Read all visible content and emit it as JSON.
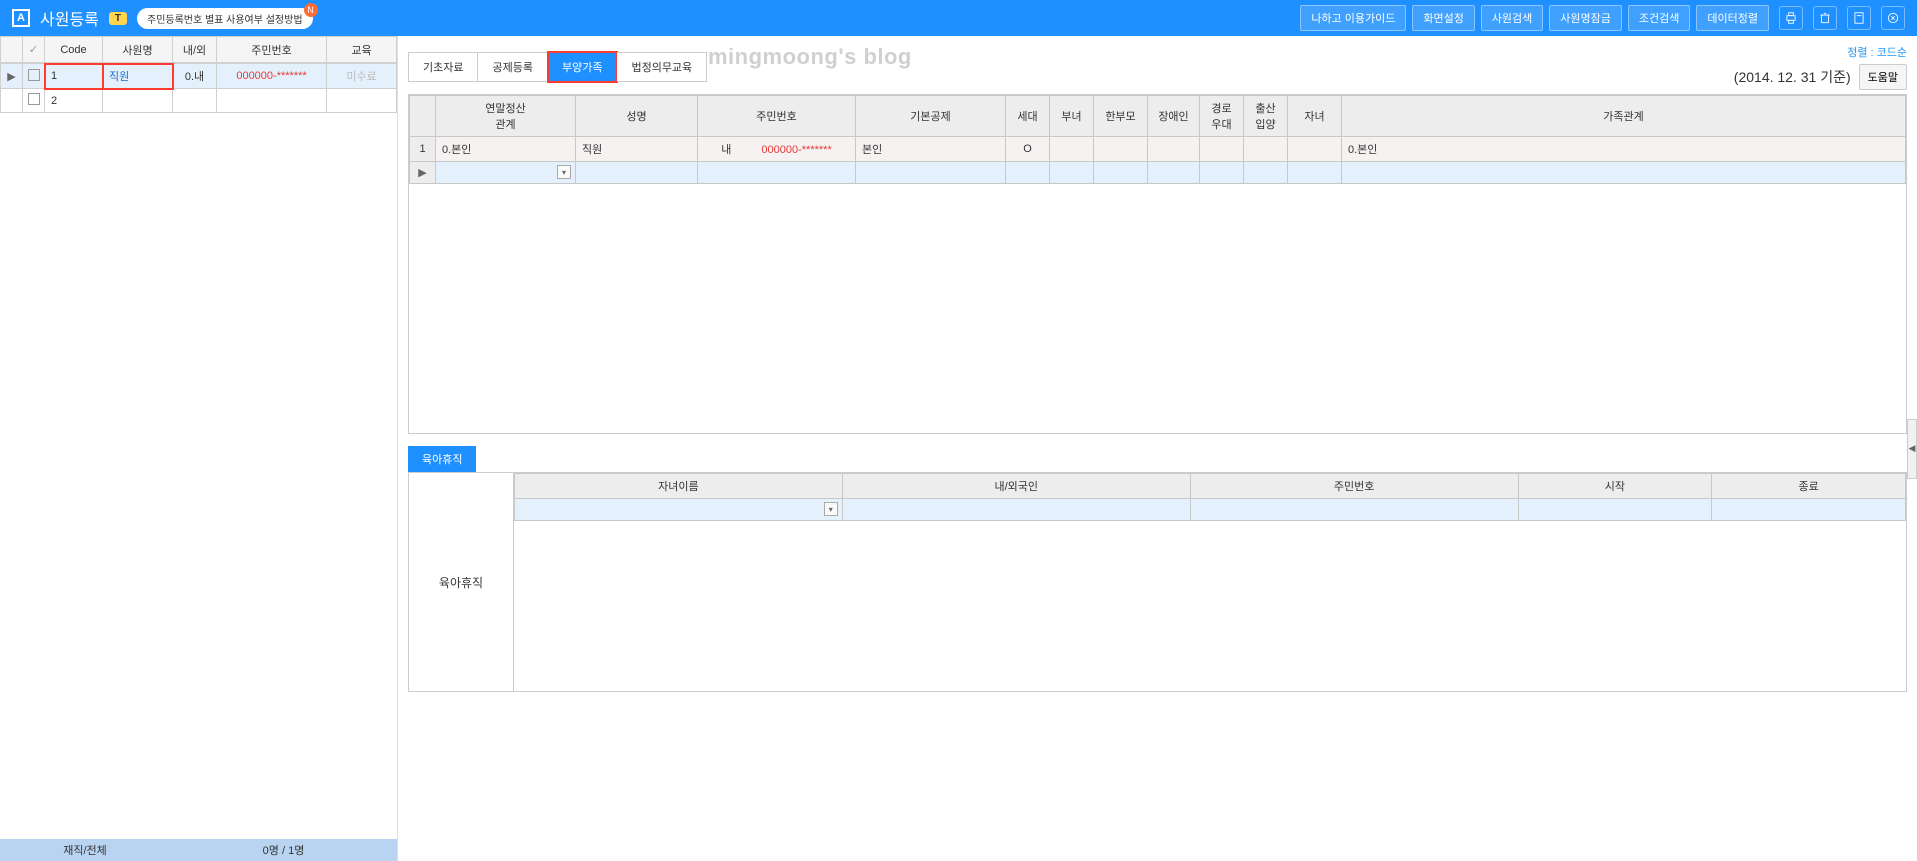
{
  "header": {
    "app_icon": "A",
    "title": "사원등록",
    "badge": "T",
    "notice": "주민등록번호 별표 사용여부 설정방법",
    "notice_badge": "N",
    "buttons": [
      "나하고 이용가이드",
      "화면설정",
      "사원검색",
      "사원명잠금",
      "조건검색",
      "데이터정렬"
    ]
  },
  "left_grid": {
    "headers": [
      "",
      "",
      "Code",
      "사원명",
      "내/외",
      "주민번호",
      "교육"
    ],
    "rows": [
      {
        "arrow": "▶",
        "checked": false,
        "code": "1",
        "name": "직원",
        "inout": "0.내",
        "jumin": "000000-*******",
        "edu": "미수료"
      },
      {
        "arrow": "",
        "checked": false,
        "code": "2",
        "name": "",
        "inout": "",
        "jumin": "",
        "edu": ""
      }
    ],
    "footer_label": "재직/전체",
    "footer_value": "0명 / 1명"
  },
  "right": {
    "tabs": [
      "기초자료",
      "공제등록",
      "부양가족",
      "법정의무교육"
    ],
    "active_tab": 2,
    "watermark": "mingmoong's blog",
    "sort_link": "정렬 : 코드순",
    "date_std": "(2014. 12. 31 기준)",
    "help": "도움말",
    "dep_headers": [
      "",
      "연말정산\n관계",
      "성명",
      "주민번호",
      "기본공제",
      "세대",
      "부녀",
      "한부모",
      "장애인",
      "경로\n우대",
      "출산\n입양",
      "자녀",
      "가족관계"
    ],
    "dep_rows": [
      {
        "num": "1",
        "rel": "0.본인",
        "name": "직원",
        "jumin_pre": "내",
        "jumin": "000000-*******",
        "basic": "본인",
        "sede": "O",
        "bunyo": "",
        "single": "",
        "disable": "",
        "elder": "",
        "birth": "",
        "child": "",
        "family": "0.본인"
      }
    ]
  },
  "lower": {
    "subtab": "육아휴직",
    "side_label": "육아휴직",
    "headers": [
      "자녀이름",
      "내/외국인",
      "주민번호",
      "시작",
      "종료"
    ]
  }
}
